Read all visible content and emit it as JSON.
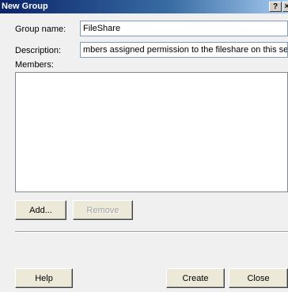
{
  "window": {
    "title": "New Group",
    "help_glyph": "?",
    "close_glyph": "×"
  },
  "form": {
    "group_name_label": "Group name:",
    "group_name_value": "FileShare",
    "description_label": "Description:",
    "description_value": "mbers assigned permission to the fileshare on this server",
    "members_label": "Members:"
  },
  "buttons": {
    "add": "Add...",
    "remove": "Remove",
    "help": "Help",
    "create": "Create",
    "close": "Close"
  }
}
